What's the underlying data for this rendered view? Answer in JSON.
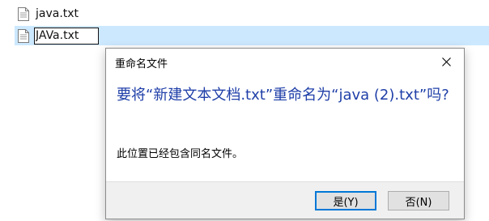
{
  "file_list": {
    "items": [
      {
        "name": "java.txt",
        "icon": "text-file-icon"
      },
      {
        "name": "JAVa.txt",
        "icon": "text-file-icon",
        "renaming": true
      }
    ],
    "selection_color": "#cce8ff"
  },
  "dialog": {
    "title": "重命名文件",
    "close_icon": "close-icon",
    "main_instruction": "要将“新建文本文档.txt”重命名为“java (2).txt”吗?",
    "content": "此位置已经包含同名文件。",
    "buttons": {
      "yes": "是(Y)",
      "no": "否(N)"
    },
    "accent_color": "#0078d7",
    "instruction_color": "#1f3fa8"
  }
}
